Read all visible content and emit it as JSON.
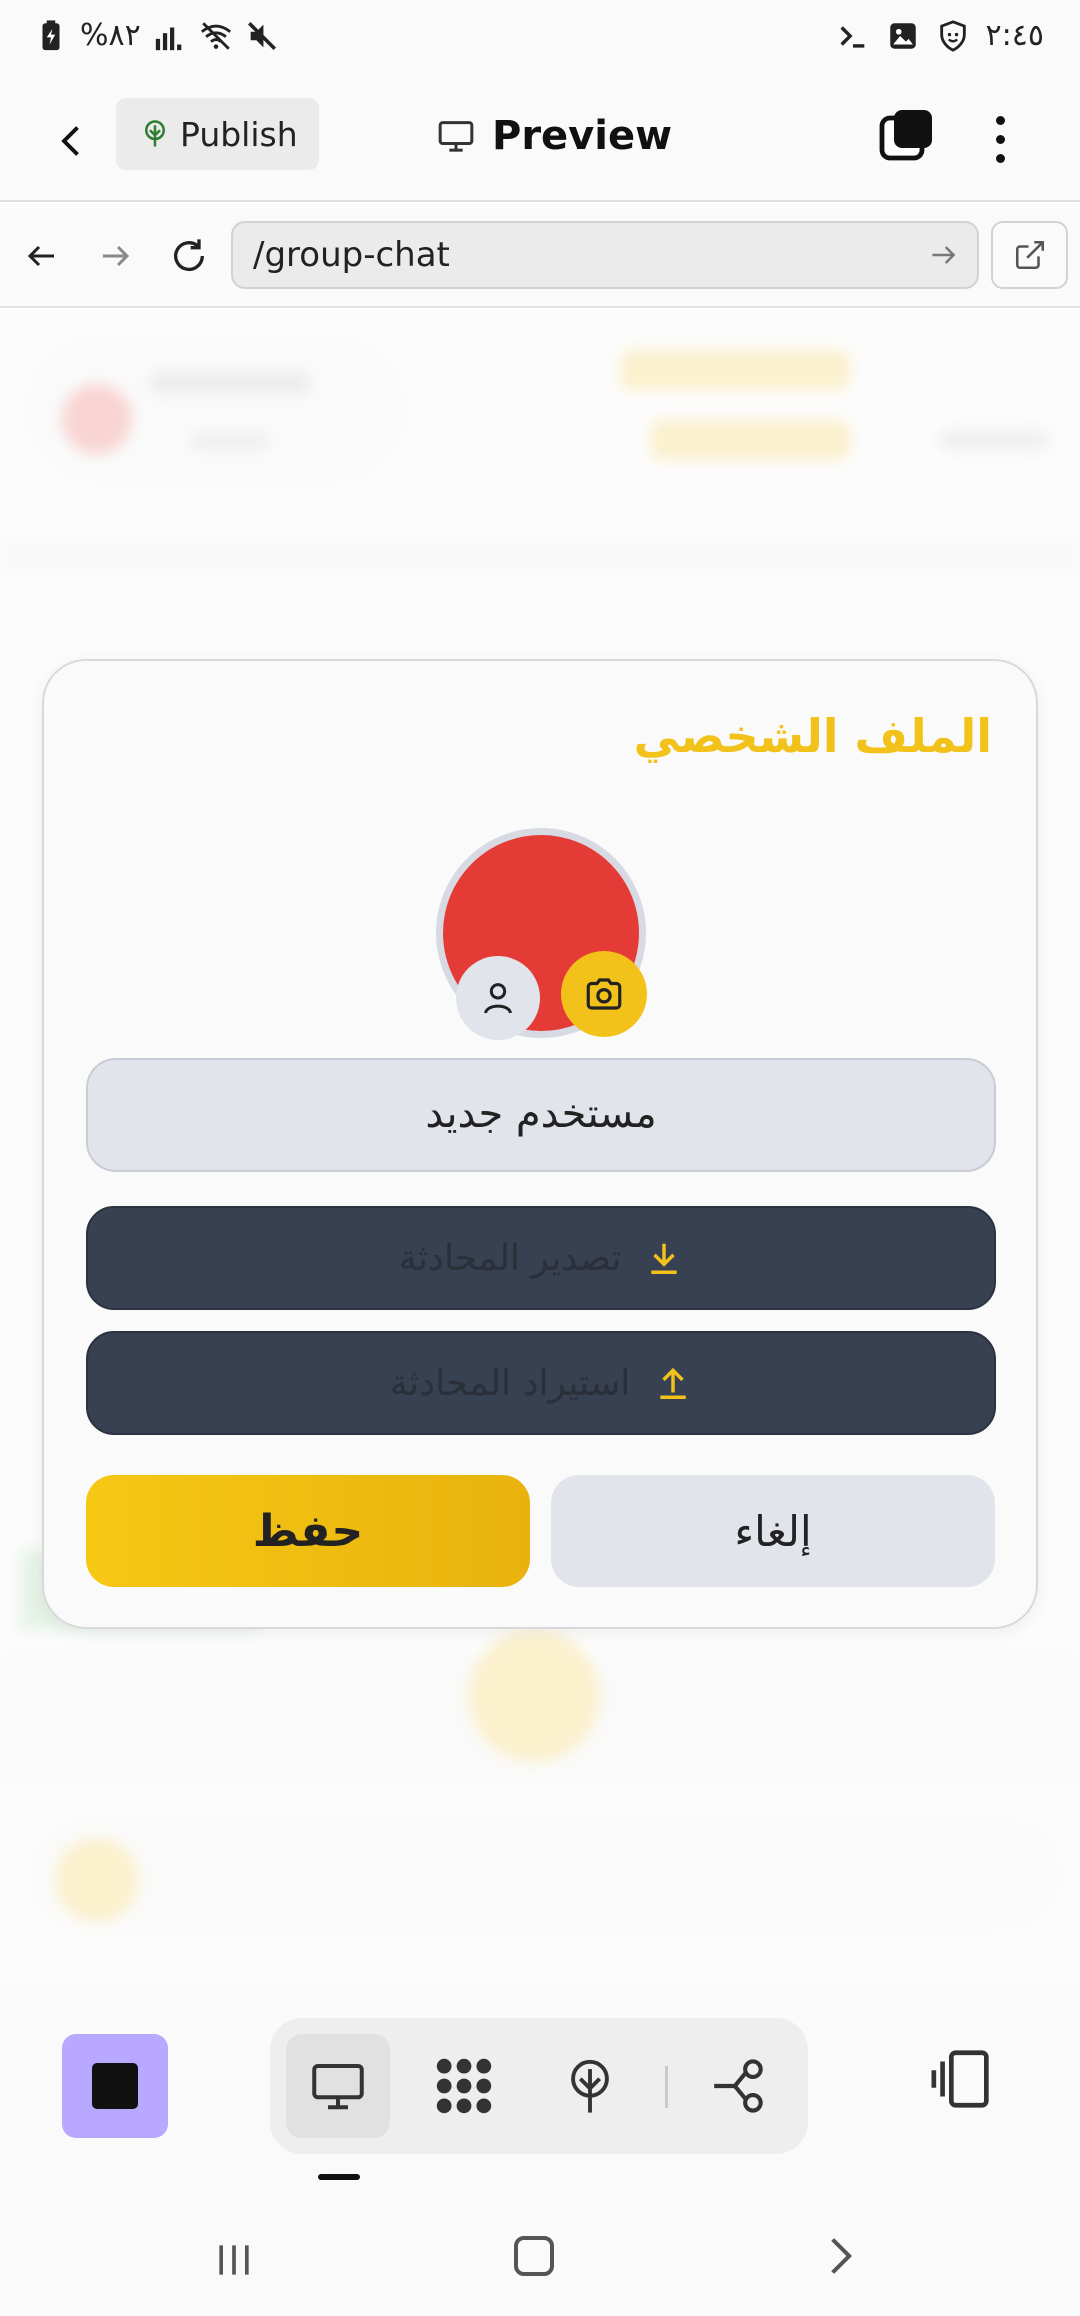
{
  "status_bar": {
    "battery": "%٨٢",
    "time": "٢:٤٥"
  },
  "app_bar": {
    "publish_label": "Publish",
    "preview_label": "Preview"
  },
  "url_bar": {
    "url": "/group-chat"
  },
  "modal": {
    "title": "الملف الشخصي",
    "name_value": "مستخدم جديد",
    "export_label": "تصدير المحادثة",
    "import_label": "استيراد المحادثة",
    "save_label": "حفظ",
    "cancel_label": "إلغاء"
  },
  "colors": {
    "accent_yellow": "#f2c21b",
    "avatar_red": "#e53b36",
    "dark_button": "#374151",
    "stop_button": "#b9a8ff"
  },
  "icons": {
    "status_left": [
      "battery-charging-icon",
      "signal-icon",
      "wifi-off-icon",
      "mute-icon"
    ],
    "status_right": [
      "terminal-icon",
      "gallery-icon",
      "shield-icon"
    ],
    "toolbar": [
      "monitor-icon",
      "grid-flower-icon",
      "publish-tree-icon",
      "share-nodes-icon"
    ]
  }
}
